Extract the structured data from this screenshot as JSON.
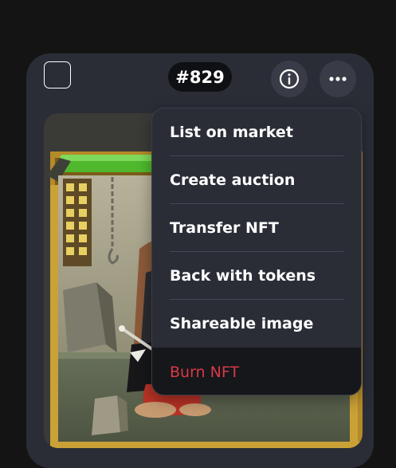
{
  "header": {
    "token_id": "#829"
  },
  "menu": {
    "items": [
      {
        "label": "List on market"
      },
      {
        "label": "Create auction"
      },
      {
        "label": "Transfer NFT"
      },
      {
        "label": "Back with tokens"
      },
      {
        "label": "Shareable image"
      },
      {
        "label": "Burn NFT"
      }
    ]
  },
  "colors": {
    "page_background": "#141414",
    "card_background": "#2a2d36",
    "danger": "#d83a45",
    "frame_gold": "#b58a28",
    "bar_green": "#4fb82c"
  },
  "icons": {
    "checkbox": "square-checkbox",
    "info": "info-circle-icon",
    "more": "more-horizontal-icon"
  }
}
